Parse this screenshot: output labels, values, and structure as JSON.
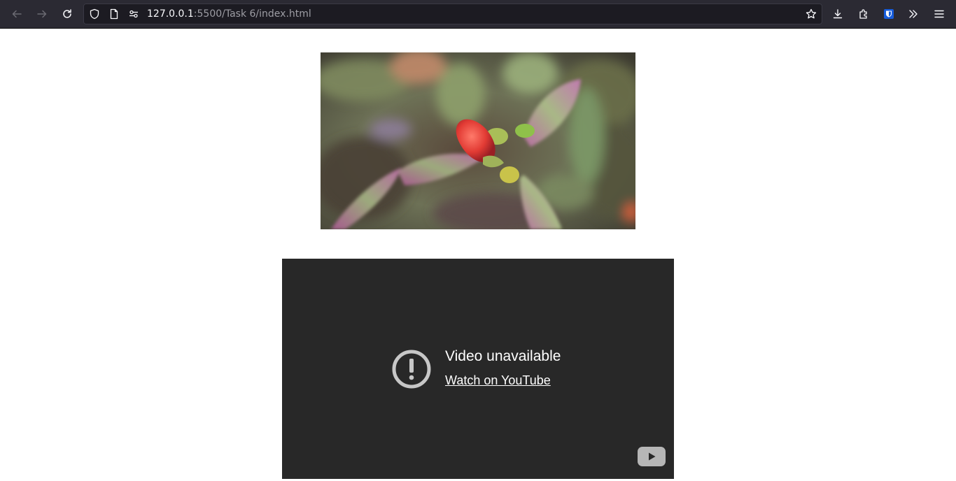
{
  "browser": {
    "url_host": "127.0.0.1",
    "url_rest": ":5500/Task 6/index.html",
    "icons": [
      "back-icon",
      "forward-icon",
      "reload-icon",
      "shield-icon",
      "page-icon",
      "permissions-icon",
      "bookmark-star-icon",
      "download-icon",
      "extensions-icon",
      "bitwarden-icon",
      "overflow-chevron-icon",
      "menu-icon"
    ]
  },
  "page": {
    "image_alt": "Red flower bud among purple-edged leaves",
    "video": {
      "error_title": "Video unavailable",
      "link_label": "Watch on YouTube",
      "background": "#282828"
    }
  },
  "colors": {
    "toolbar_bg": "#2b2a33",
    "urlbar_bg": "#1c1b22",
    "accent_blue": "#0060df"
  }
}
